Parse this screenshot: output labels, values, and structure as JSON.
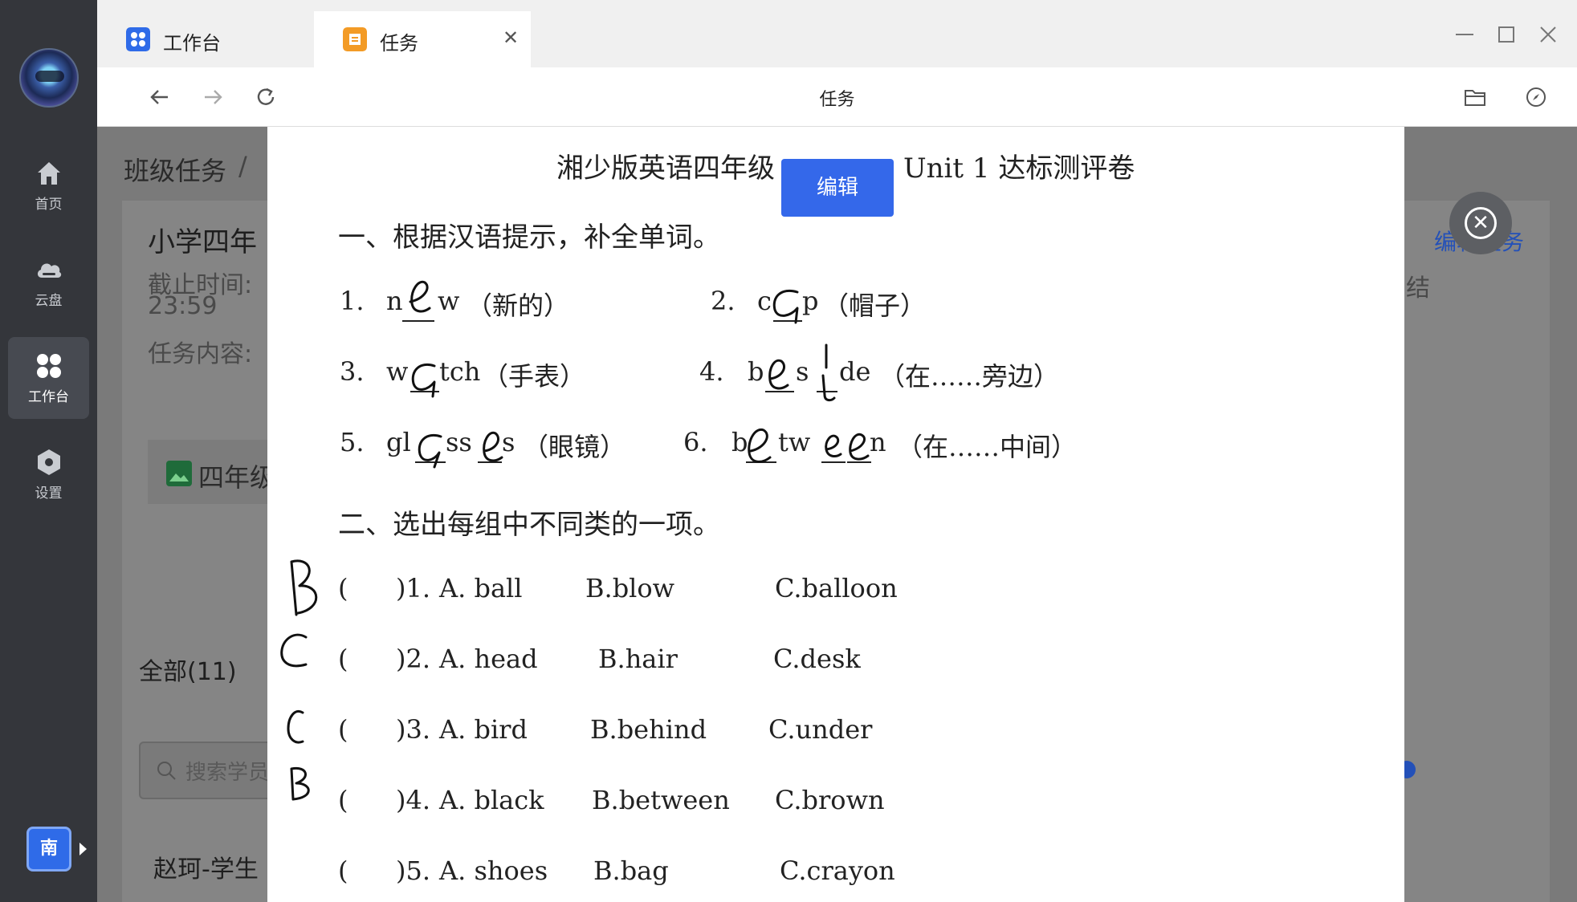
{
  "sidebar": {
    "items": [
      {
        "label": "首页",
        "icon": "home-icon"
      },
      {
        "label": "云盘",
        "icon": "cloud-icon"
      },
      {
        "label": "工作台",
        "icon": "workbench-icon",
        "active": true
      },
      {
        "label": "设置",
        "icon": "settings-icon"
      }
    ],
    "bottom_badge": "南"
  },
  "tabs": [
    {
      "label": "工作台",
      "icon": "workbench-icon",
      "active": false
    },
    {
      "label": "任务",
      "icon": "task-icon",
      "active": true
    }
  ],
  "address": {
    "title": "任务"
  },
  "background": {
    "breadcrumb_root": "班级任务",
    "breadcrumb_sep": "/",
    "task_title": "小学四年",
    "deadline_label": "截止时间:",
    "deadline_time": "23:59",
    "content_label": "任务内容:",
    "attachment_name": "四年级",
    "edit_task_link": "编辑任务",
    "status_char": "结",
    "filter_all": "全部(11)",
    "search_placeholder": "搜索学员",
    "student_name": "赵珂-学生"
  },
  "modal": {
    "edit_button": "编辑",
    "close_icon": "close-circle-icon",
    "doc_title_left": "湘少版英语四年级",
    "doc_title_right": "Unit 1  达标测评卷",
    "section1": "一、根据汉语提示，补全单词。",
    "q1": {
      "num": "1.",
      "a": "n",
      "b": "w",
      "hint": "（新的）"
    },
    "q2": {
      "num": "2.",
      "a": "c",
      "b": "p",
      "hint": "（帽子）"
    },
    "q3": {
      "num": "3.",
      "a": "w",
      "b": "tch",
      "hint": "（手表）"
    },
    "q4": {
      "num": "4.",
      "a": "b",
      "b": "s",
      "c": "de",
      "hint": "（在……旁边）"
    },
    "q5": {
      "num": "5.",
      "a": "gl",
      "b": "ss",
      "c": "s",
      "hint": "（眼镜）"
    },
    "q6": {
      "num": "6.",
      "a": "b",
      "b": "tw",
      "c": "n",
      "hint": "（在……中间）"
    },
    "section2": "二、选出每组中不同类的一项。",
    "choices": [
      {
        "paren": "(",
        "num": ")1.",
        "a": "A. ball",
        "b": "B.blow",
        "c": "C.balloon"
      },
      {
        "paren": "(",
        "num": ")2.",
        "a": "A. head",
        "b": "B.hair",
        "c": "C.desk"
      },
      {
        "paren": "(",
        "num": ")3.",
        "a": "A. bird",
        "b": "B.behind",
        "c": "C.under"
      },
      {
        "paren": "(",
        "num": ")4.",
        "a": "A. black",
        "b": "B.between",
        "c": "C.brown"
      },
      {
        "paren": "(",
        "num": ")5.",
        "a": "A. shoes",
        "b": "B.bag",
        "c": "C.crayon"
      }
    ]
  }
}
